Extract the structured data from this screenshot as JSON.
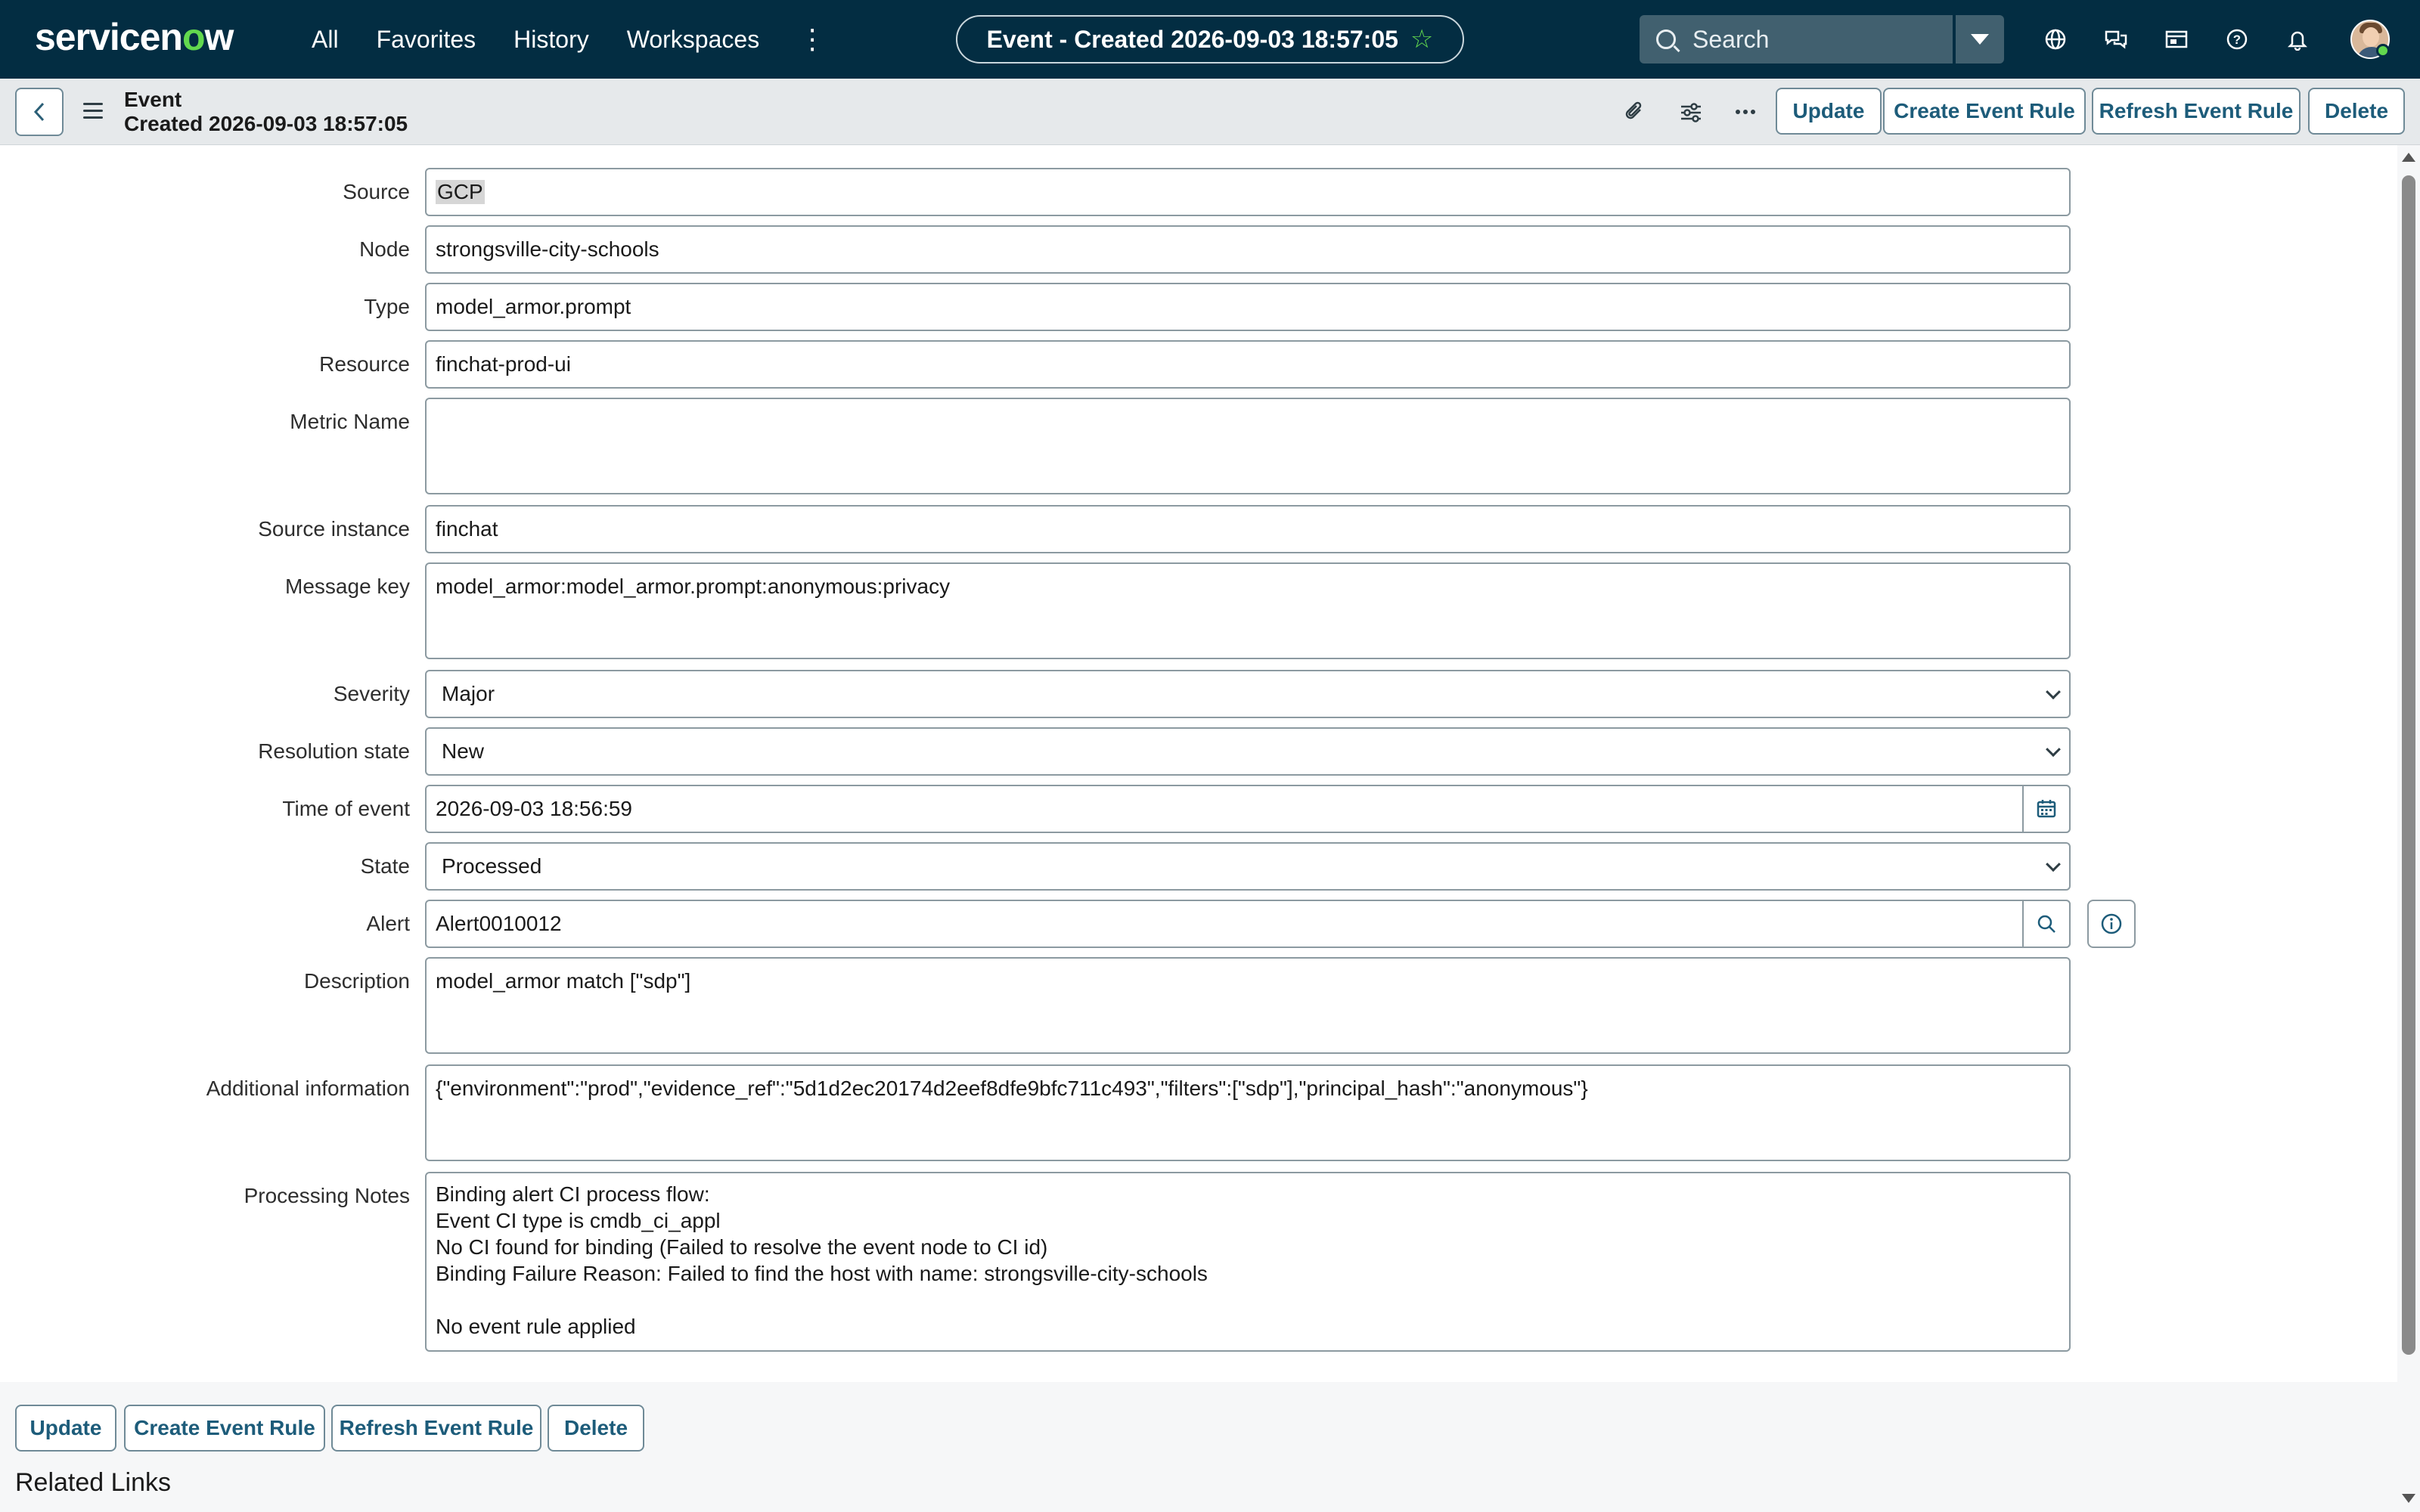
{
  "nav": {
    "logo_main": "servicen",
    "logo_accent": "o",
    "logo_tail": "w",
    "links": [
      "All",
      "Favorites",
      "History",
      "Workspaces"
    ],
    "title": "Event - Created 2026-09-03 18:57:05",
    "search_placeholder": "Search",
    "icons": [
      "globe-icon",
      "chat-icon",
      "inbox-icon",
      "help-icon",
      "bell-icon"
    ]
  },
  "header": {
    "record_type": "Event",
    "record_subtitle": "Created 2026-09-03 18:57:05",
    "buttons": {
      "update": "Update",
      "create_rule": "Create Event Rule",
      "refresh_rule": "Refresh Event Rule",
      "delete": "Delete"
    }
  },
  "form": {
    "source": {
      "label": "Source",
      "value": "GCP"
    },
    "node": {
      "label": "Node",
      "value": "strongsville-city-schools"
    },
    "type": {
      "label": "Type",
      "value": "model_armor.prompt"
    },
    "resource": {
      "label": "Resource",
      "value": "finchat-prod-ui"
    },
    "metric_name": {
      "label": "Metric Name",
      "value": ""
    },
    "source_instance": {
      "label": "Source instance",
      "value": "finchat"
    },
    "message_key": {
      "label": "Message key",
      "value": "model_armor:model_armor.prompt:anonymous:privacy"
    },
    "severity": {
      "label": "Severity",
      "value": "Major"
    },
    "resolution_state": {
      "label": "Resolution state",
      "value": "New"
    },
    "time_of_event": {
      "label": "Time of event",
      "value": "2026-09-03 18:56:59"
    },
    "state": {
      "label": "State",
      "value": "Processed"
    },
    "alert": {
      "label": "Alert",
      "value": "Alert0010012"
    },
    "description": {
      "label": "Description",
      "value": "model_armor match [\"sdp\"]"
    },
    "additional_info": {
      "label": "Additional information",
      "value": "{\"environment\":\"prod\",\"evidence_ref\":\"5d1d2ec20174d2eef8dfe9bfc711c493\",\"filters\":[\"sdp\"],\"principal_hash\":\"anonymous\"}"
    },
    "processing_notes": {
      "label": "Processing Notes",
      "lines": [
        "Binding alert CI process flow:",
        "Event CI type is cmdb_ci_appl",
        "No CI found for binding (Failed to resolve the event node to CI id)",
        "Binding Failure Reason: Failed to find the host with name: strongsville-city-schools",
        "",
        "No event rule applied"
      ]
    }
  },
  "footer": {
    "related_links": "Related Links"
  },
  "colors": {
    "nav_bg": "#032d42",
    "accent_green": "#62d84e",
    "button_text": "#1d5c7a"
  }
}
